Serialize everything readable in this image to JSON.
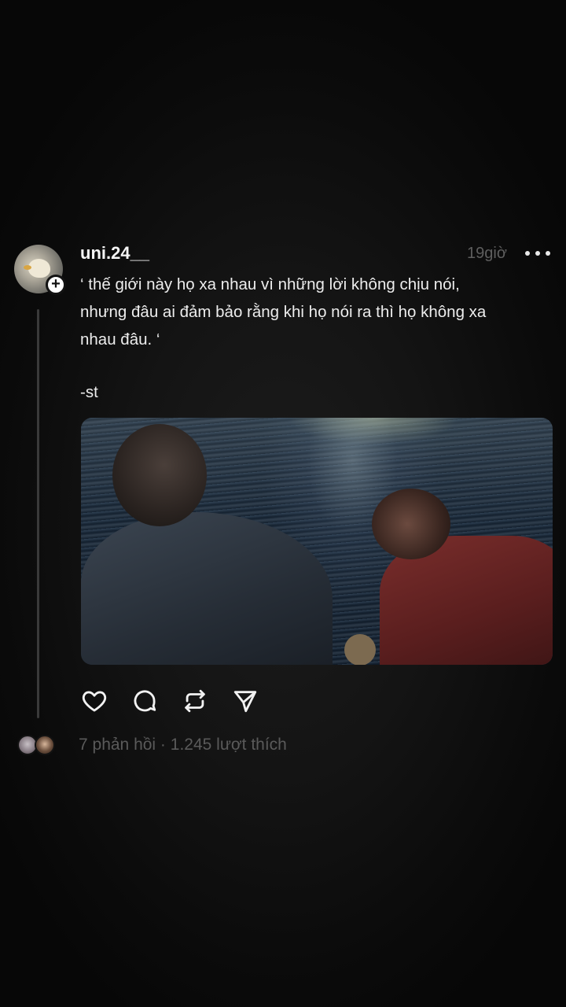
{
  "post": {
    "username": "uni.24__",
    "time": "19giờ",
    "caption": "‘ thế giới này họ xa nhau vì những lời không chịu nói,\nnhưng đâu ai đảm bảo rằng khi họ nói ra thì họ không xa\nnhau đâu. ‘",
    "signature": "-st",
    "image": {
      "description_icon": "photo-icon"
    }
  },
  "actions": {
    "like": "heart-icon",
    "comment": "comment-icon",
    "repost": "repost-icon",
    "share": "send-icon"
  },
  "stats": {
    "replies": "7 phản hồi",
    "separator": " · ",
    "likes": "1.245 lượt thích"
  },
  "colors": {
    "background": "#101010",
    "text_primary": "#f2f2f2",
    "text_muted": "#5a5a5a"
  }
}
